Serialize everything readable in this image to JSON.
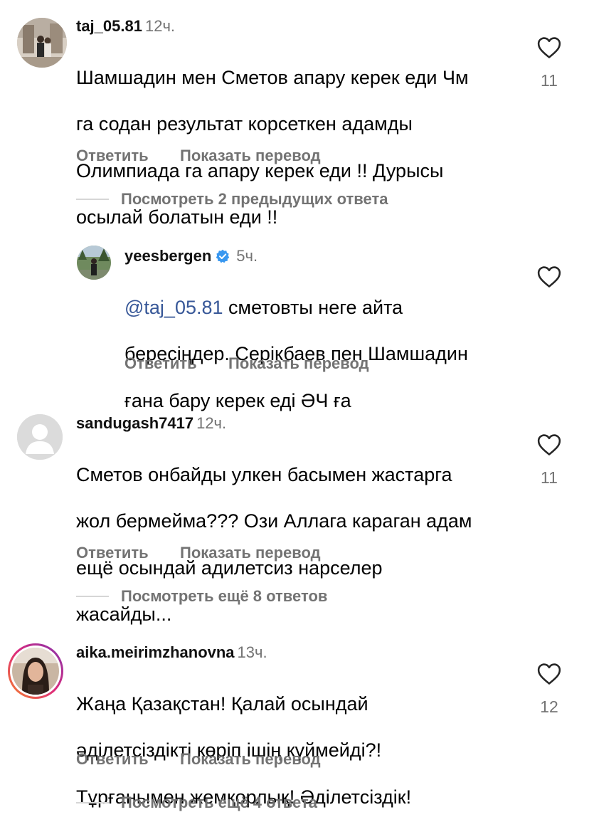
{
  "actions": {
    "reply": "Ответить",
    "translate": "Показать перевод"
  },
  "comments": [
    {
      "username": "taj_05.81",
      "time": "12ч.",
      "lines": [
        "Шамшадин мен Сметов апару керек еди Чм",
        "га содан результат корсеткен адамды",
        "Олимпиада га апару керек еди !! Дурысы",
        "осылай болатын еди !!"
      ],
      "likes": "11",
      "view_replies": "Посмотреть 2 предыдущих ответа"
    },
    {
      "username": "yeesbergen",
      "time": "5ч.",
      "verified": true,
      "mention": "@taj_05.81",
      "text_after_mention": " сметовты неге айта",
      "lines": [
        "бересіңдер. Серікбаев пен Шамшадин",
        "ғана бару керек еді ӘЧ ға"
      ]
    },
    {
      "username": "sandugash7417",
      "time": "12ч.",
      "lines": [
        "Сметов онбайды улкен басымен жастарга",
        "жол бермейма??? Ози Аллага караган адам",
        "ещё осындай адилетсиз нарселер",
        "жасайды..."
      ],
      "likes": "11",
      "view_replies": "Посмотреть ещё 8 ответов"
    },
    {
      "username": "aika.meirimzhanovna",
      "time": "13ч.",
      "lines": [
        "Жаңа Қазақстан! Қалай осындай",
        "әділетсіздікті көріп ішің күймейді?!",
        "Тұрғанымен жемқорлық! Әділетсіздік!"
      ],
      "likes": "12",
      "view_replies": "Посмотреть ещё 4 ответа"
    }
  ],
  "colors": {
    "secondary_text": "#737373",
    "mention": "#385898",
    "verified": "#3897f0",
    "story_ring": [
      "#f58529",
      "#dd2a7b",
      "#8134af"
    ]
  }
}
